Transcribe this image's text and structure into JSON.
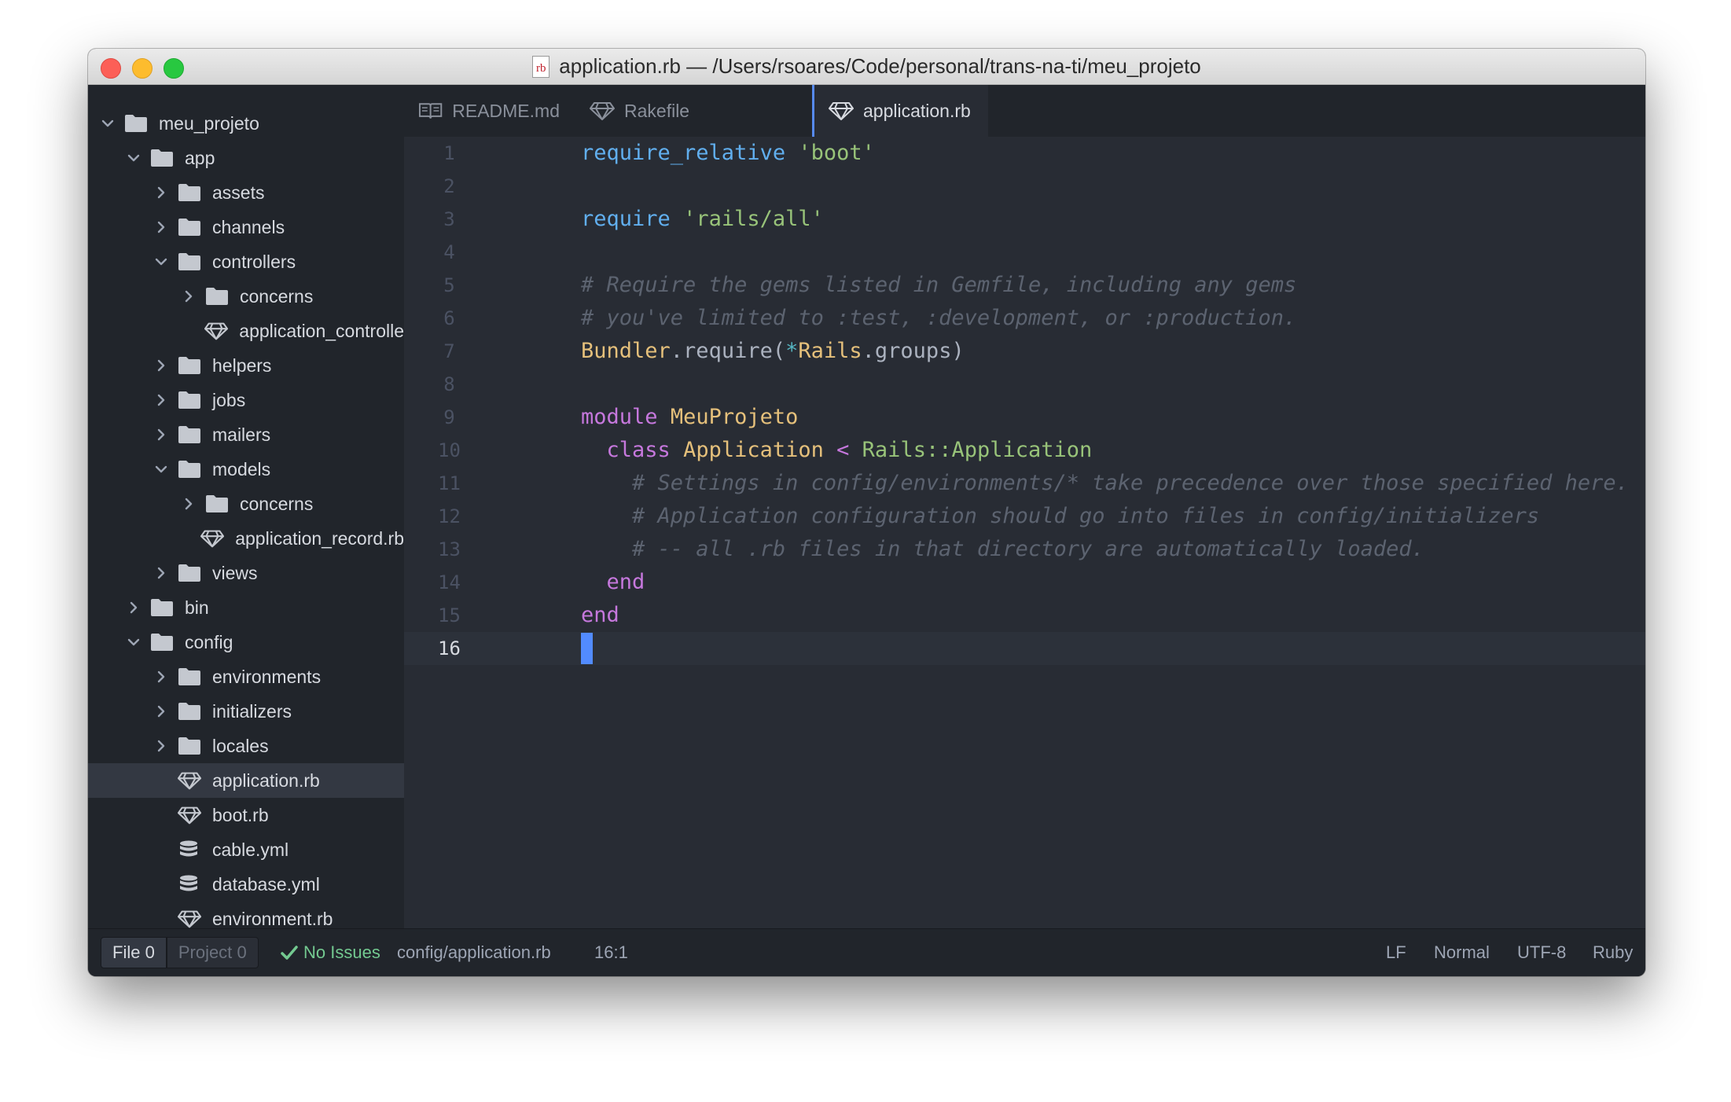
{
  "window": {
    "title": "application.rb — /Users/rsoares/Code/personal/trans-na-ti/meu_projeto",
    "title_icon_text": "rb"
  },
  "tree": [
    {
      "label": "meu_projeto",
      "type": "folder",
      "expanded": true
    },
    {
      "label": "app",
      "type": "folder",
      "expanded": true
    },
    {
      "label": "assets",
      "type": "folder",
      "expanded": false
    },
    {
      "label": "channels",
      "type": "folder",
      "expanded": false
    },
    {
      "label": "controllers",
      "type": "folder",
      "expanded": true
    },
    {
      "label": "concerns",
      "type": "folder",
      "expanded": false
    },
    {
      "label": "application_controlle",
      "type": "ruby-file"
    },
    {
      "label": "helpers",
      "type": "folder",
      "expanded": false
    },
    {
      "label": "jobs",
      "type": "folder",
      "expanded": false
    },
    {
      "label": "mailers",
      "type": "folder",
      "expanded": false
    },
    {
      "label": "models",
      "type": "folder",
      "expanded": true
    },
    {
      "label": "concerns",
      "type": "folder",
      "expanded": false
    },
    {
      "label": "application_record.rb",
      "type": "ruby-file"
    },
    {
      "label": "views",
      "type": "folder",
      "expanded": false
    },
    {
      "label": "bin",
      "type": "folder",
      "expanded": false
    },
    {
      "label": "config",
      "type": "folder",
      "expanded": true
    },
    {
      "label": "environments",
      "type": "folder",
      "expanded": false
    },
    {
      "label": "initializers",
      "type": "folder",
      "expanded": false
    },
    {
      "label": "locales",
      "type": "folder",
      "expanded": false
    },
    {
      "label": "application.rb",
      "type": "ruby-file",
      "selected": true
    },
    {
      "label": "boot.rb",
      "type": "ruby-file"
    },
    {
      "label": "cable.yml",
      "type": "database-file"
    },
    {
      "label": "database.yml",
      "type": "database-file"
    },
    {
      "label": "environment.rb",
      "type": "ruby-file"
    }
  ],
  "tabs": [
    {
      "label": "README.md",
      "icon": "book-icon",
      "active": false
    },
    {
      "label": "Rakefile",
      "icon": "ruby-gem-icon",
      "active": false
    },
    {
      "label": "application.rb",
      "icon": "ruby-gem-icon",
      "active": true
    }
  ],
  "editor": {
    "line_numbers": [
      "1",
      "2",
      "3",
      "4",
      "5",
      "6",
      "7",
      "8",
      "9",
      "10",
      "11",
      "12",
      "13",
      "14",
      "15",
      "16"
    ],
    "current_line": 16,
    "lines": [
      [
        {
          "t": "require_relative",
          "c": "fn"
        },
        {
          "t": " ",
          "c": ""
        },
        {
          "t": "'boot'",
          "c": "str"
        }
      ],
      [],
      [
        {
          "t": "require",
          "c": "fn"
        },
        {
          "t": " ",
          "c": ""
        },
        {
          "t": "'rails/all'",
          "c": "str"
        }
      ],
      [],
      [
        {
          "t": "# Require the gems listed in Gemfile, including any gems",
          "c": "cm"
        }
      ],
      [
        {
          "t": "# you've limited to :test, :development, or :production.",
          "c": "cm"
        }
      ],
      [
        {
          "t": "Bundler",
          "c": "cls"
        },
        {
          "t": ".require(",
          "c": ""
        },
        {
          "t": "*",
          "c": "op"
        },
        {
          "t": "Rails",
          "c": "cls"
        },
        {
          "t": ".groups)",
          "c": ""
        }
      ],
      [],
      [
        {
          "t": "module",
          "c": "kw"
        },
        {
          "t": " ",
          "c": ""
        },
        {
          "t": "MeuProjeto",
          "c": "cls"
        }
      ],
      [
        {
          "t": "  ",
          "c": ""
        },
        {
          "t": "class",
          "c": "kw"
        },
        {
          "t": " ",
          "c": ""
        },
        {
          "t": "Application",
          "c": "cls"
        },
        {
          "t": " ",
          "c": ""
        },
        {
          "t": "<",
          "c": "kw"
        },
        {
          "t": " ",
          "c": ""
        },
        {
          "t": "Rails::Application",
          "c": "str"
        }
      ],
      [
        {
          "t": "    # Settings in config/environments/* take precedence over those specified here.",
          "c": "cm"
        }
      ],
      [
        {
          "t": "    # Application configuration should go into files in config/initializers",
          "c": "cm"
        }
      ],
      [
        {
          "t": "    # -- all .rb files in that directory are automatically loaded.",
          "c": "cm"
        }
      ],
      [
        {
          "t": "  ",
          "c": ""
        },
        {
          "t": "end",
          "c": "kw"
        }
      ],
      [
        {
          "t": "end",
          "c": "kw"
        }
      ],
      []
    ]
  },
  "status": {
    "file_label": "File",
    "file_count": "0",
    "project_label": "Project",
    "project_count": "0",
    "linter_text": "No Issues",
    "path": "config/application.rb",
    "cursor_pos": "16:1",
    "line_ending": "LF",
    "mode": "Normal",
    "encoding": "UTF-8",
    "grammar": "Ruby"
  },
  "colors": {
    "accent": "#568af2",
    "string": "#98c379",
    "function": "#61afef",
    "keyword": "#c678dd",
    "class": "#e5c07b",
    "comment": "#5c6370",
    "ok": "#73c990"
  }
}
